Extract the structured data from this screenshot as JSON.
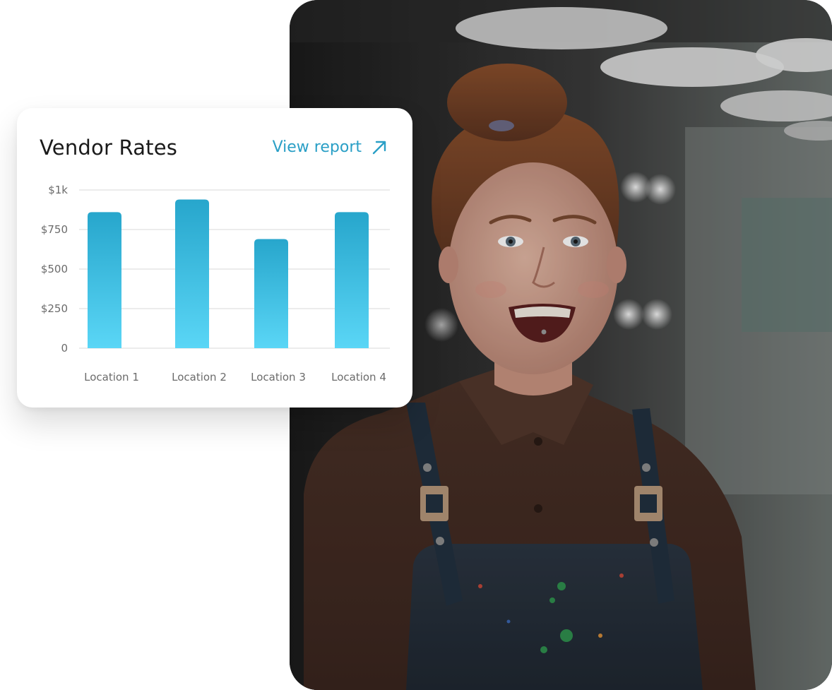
{
  "card": {
    "title": "Vendor Rates",
    "link_label": "View report",
    "link_icon": "arrow-up-right-icon"
  },
  "colors": {
    "accent": "#2a9fc6",
    "bar_top": "#27a6cc",
    "bar_bottom": "#5ad6f6",
    "grid": "#ececec",
    "tick_text": "#6b6b6b"
  },
  "chart_data": {
    "type": "bar",
    "title": "Vendor Rates",
    "categories": [
      "Location 1",
      "Location 2",
      "Location 3",
      "Location 4"
    ],
    "values": [
      860,
      940,
      690,
      860
    ],
    "ylim": [
      0,
      1000
    ],
    "yticks": [
      {
        "value": 0,
        "label": "0"
      },
      {
        "value": 250,
        "label": "$250"
      },
      {
        "value": 500,
        "label": "$500"
      },
      {
        "value": 750,
        "label": "$750"
      },
      {
        "value": 1000,
        "label": "$1k"
      }
    ],
    "grid": true,
    "legend": "none"
  }
}
